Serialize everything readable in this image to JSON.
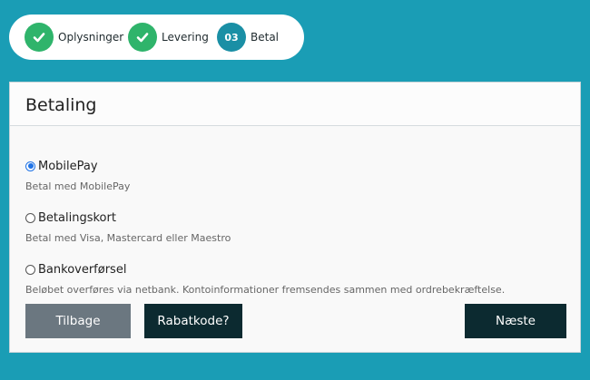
{
  "stepper": {
    "steps": [
      {
        "label": "Oplysninger",
        "state": "done",
        "icon": "check-icon"
      },
      {
        "label": "Levering",
        "state": "done",
        "icon": "check-icon"
      },
      {
        "label": "Betal",
        "state": "current",
        "number": "03"
      }
    ]
  },
  "payment": {
    "title": "Betaling",
    "options": [
      {
        "label": "MobilePay",
        "description": "Betal med MobilePay",
        "selected": true
      },
      {
        "label": "Betalingskort",
        "description": "Betal med Visa, Mastercard eller Maestro",
        "selected": false
      },
      {
        "label": "Bankoverførsel",
        "description": "Beløbet overføres via netbank. Kontoinformationer fremsendes sammen med ordrebekræftelse.",
        "selected": false
      }
    ]
  },
  "buttons": {
    "back": "Tilbage",
    "discount": "Rabatkode?",
    "next": "Næste"
  },
  "colors": {
    "background": "#1a9db5",
    "step_done": "#2fb46b",
    "step_current": "#1a8fa5",
    "primary_button": "#0c2a30",
    "secondary_button": "#6b7780"
  }
}
